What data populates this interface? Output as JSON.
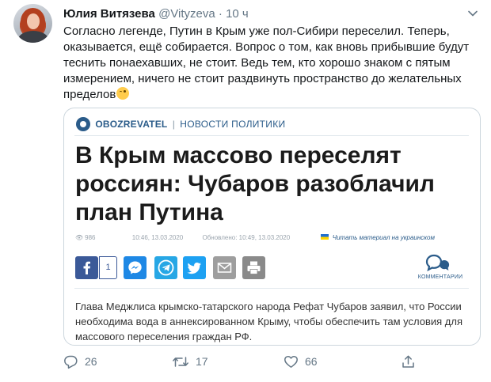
{
  "tweet": {
    "author_name": "Юлия Витязева",
    "handle": "@Vityzeva",
    "separator": "·",
    "time": "10 ч",
    "text": "Согласно легенде, Путин в Крым уже пол-Сибири переселил. Теперь, оказывается, ещё собирается. Вопрос о том, как вновь прибывшие будут теснить понаехавших, не стоит. Ведь тем, кто хорошо знаком с пятым измерением, ничего не стоит раздвинуть пространство до желательных пределов",
    "emoji_icon": "winking-face-icon"
  },
  "card": {
    "brand_name": "OBOZREVATEL",
    "brand_pipe": "|",
    "section": "НОВОСТИ ПОЛИТИКИ",
    "headline": "В Крым массово переселят россиян: Чубаров разоблачил план Путина",
    "views": "986",
    "published": "10:46, 13.03.2020",
    "updated": "Обновлено: 10:49, 13.03.2020",
    "ukrainian_link": "Читать материал на украинском",
    "fb_count": "1",
    "comments_label": "КОММЕНТАРИИ",
    "lead": "Глава Меджлиса крымско-татарского народа Рефат Чубаров заявил, что России необходима вода в аннексированном Крыму, чтобы обеспечить там условия для массового переселения граждан РФ."
  },
  "actions": {
    "replies": "26",
    "retweets": "17",
    "likes": "66"
  },
  "colors": {
    "brand_blue": "#2b5c8a",
    "twitter_gray": "#657786",
    "facebook": "#3b5998",
    "messenger": "#1e88e5",
    "telegram": "#27a7e5",
    "twitter": "#1da1f2"
  }
}
